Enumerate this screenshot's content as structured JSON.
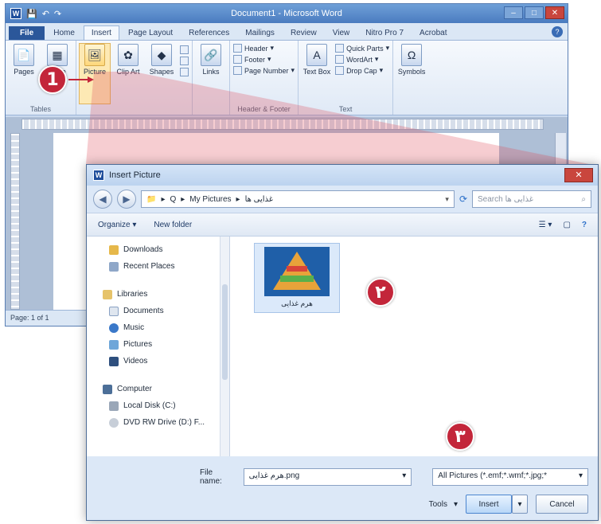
{
  "word": {
    "title": "Document1 - Microsoft Word",
    "tabs": [
      "File",
      "Home",
      "Insert",
      "Page Layout",
      "References",
      "Mailings",
      "Review",
      "View",
      "Nitro Pro 7",
      "Acrobat"
    ],
    "active_tab": "Insert",
    "groups": {
      "pages": {
        "pages_label": "Pages",
        "table_label": "Table",
        "group_label": "Tables"
      },
      "illustrations": {
        "picture_label": "Picture",
        "clipart_label": "Clip Art",
        "shapes_label": "Shapes"
      },
      "links": {
        "links_label": "Links"
      },
      "header_footer": {
        "header_label": "Header",
        "footer_label": "Footer",
        "page_number_label": "Page Number",
        "group_label": "Header & Footer"
      },
      "text": {
        "textbox_label": "Text Box",
        "quickparts_label": "Quick Parts",
        "wordart_label": "WordArt",
        "dropcap_label": "Drop Cap",
        "group_label": "Text"
      },
      "symbols": {
        "symbols_label": "Symbols"
      }
    },
    "status": "Page: 1 of 1"
  },
  "dialog": {
    "title": "Insert Picture",
    "path": [
      "Q",
      "My Pictures",
      "غذایی ها"
    ],
    "search_placeholder": "Search غذایی ها",
    "toolbar": {
      "organize": "Organize",
      "new_folder": "New folder"
    },
    "nav": {
      "favorites": [
        "Downloads",
        "Recent Places"
      ],
      "libraries_label": "Libraries",
      "libraries": [
        "Documents",
        "Music",
        "Pictures",
        "Videos"
      ],
      "computer_label": "Computer",
      "drives": [
        "Local Disk (C:)",
        "DVD RW Drive (D:) F..."
      ]
    },
    "file": {
      "caption": "هرم غذایی"
    },
    "file_name_label": "File name:",
    "file_name_value": "هرم غذایی.png",
    "file_type_value": "All Pictures (*.emf;*.wmf;*.jpg;*",
    "tools_label": "Tools",
    "insert_label": "Insert",
    "cancel_label": "Cancel"
  },
  "markers": {
    "m1": "1",
    "m2": "٢",
    "m3": "٣"
  },
  "colors": {
    "marker": "#c3263a",
    "file_tab": "#2b579a"
  }
}
